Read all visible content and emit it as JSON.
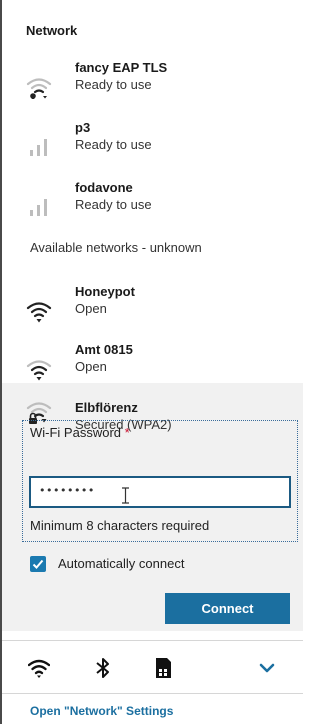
{
  "network_section": {
    "title": "Network"
  },
  "known_networks": [
    {
      "name": "fancy EAP TLS",
      "status": "Ready to use",
      "icon": "wifi-signal-icon"
    },
    {
      "name": "p3",
      "status": "Ready to use",
      "icon": "cellular-signal-icon"
    },
    {
      "name": "fodavone",
      "status": "Ready to use",
      "icon": "cellular-signal-icon"
    }
  ],
  "available_section": {
    "title": "Available networks - unknown"
  },
  "available_networks": [
    {
      "name": "Honeypot",
      "status": "Open",
      "icon": "wifi-signal-icon"
    },
    {
      "name": "Amt 0815",
      "status": "Open",
      "icon": "wifi-signal-icon"
    },
    {
      "name": "Elbflörenz",
      "status": "Secured (WPA2)",
      "icon": "wifi-locked-icon"
    }
  ],
  "password_form": {
    "label": "Wi-Fi Password",
    "required_mark": "*",
    "value": "••••••••",
    "hint": "Minimum 8 characters required",
    "auto_connect_label": "Automatically connect",
    "auto_connect_checked": true,
    "connect_label": "Connect"
  },
  "bottom_icons": [
    "wifi-icon",
    "bluetooth-icon",
    "sim-card-icon",
    "chevron-down-icon"
  ],
  "settings_link": "Open \"Network\" Settings",
  "colors": {
    "accent": "#1b6fa0",
    "required": "#c8102e",
    "expanded_bg": "#f1f1f1"
  }
}
